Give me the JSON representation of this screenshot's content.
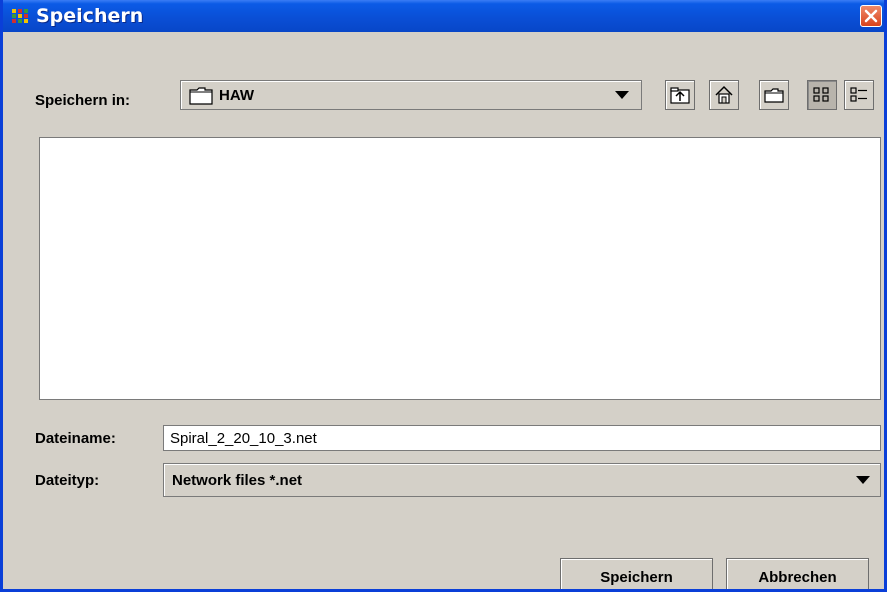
{
  "window": {
    "title": "Speichern"
  },
  "toolbar": {
    "save_in_label": "Speichern in:",
    "current_folder": "HAW",
    "buttons": [
      {
        "name": "up-one-level",
        "icon": "folder-up-icon"
      },
      {
        "name": "home",
        "icon": "home-icon"
      },
      {
        "name": "new-folder",
        "icon": "new-folder-icon"
      },
      {
        "name": "list-view",
        "icon": "list-view-icon",
        "active": true
      },
      {
        "name": "details-view",
        "icon": "details-view-icon",
        "active": false
      }
    ]
  },
  "file_list": {
    "items": []
  },
  "fields": {
    "filename_label": "Dateiname:",
    "filename_value": "Spiral_2_20_10_3.net",
    "filetype_label": "Dateityp:",
    "filetype_value": "Network files *.net"
  },
  "actions": {
    "save_label": "Speichern",
    "cancel_label": "Abbrechen"
  },
  "colors": {
    "titlebar": "#0a4fd6",
    "dialog_bg": "#d4d0c8",
    "close_button": "#d8431c"
  }
}
